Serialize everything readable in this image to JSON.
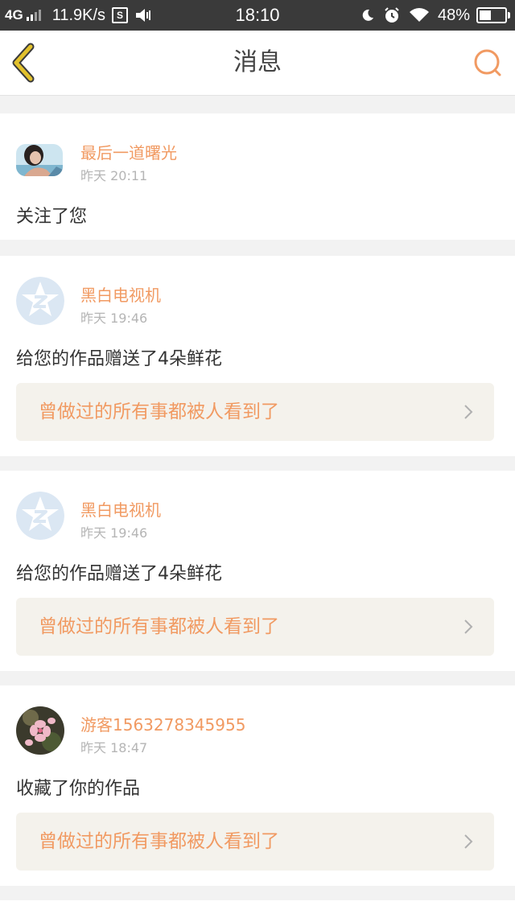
{
  "status_bar": {
    "network": "4G",
    "speed": "11.9K/s",
    "sim_label": "S",
    "time": "18:10",
    "battery": "48%",
    "battery_level": 0.48
  },
  "header": {
    "title": "消息",
    "back_icon": "chevron-left-icon",
    "search_icon": "search-icon"
  },
  "colors": {
    "accent": "#f19a62",
    "back_arrow": "#e2c12c",
    "text": "#333333",
    "muted": "#b5b5b5",
    "work_box_bg": "#f4f2ec"
  },
  "messages": [
    {
      "username": "最后一道曙光",
      "time": "昨天 20:11",
      "action": "关注了您",
      "avatar": "user-photo"
    },
    {
      "username": "黑白电视机",
      "time": "昨天 19:46",
      "action": "给您的作品赠送了4朵鲜花",
      "work_title": "曾做过的所有事都被人看到了",
      "avatar": "default-avatar-icon"
    },
    {
      "username": "黑白电视机",
      "time": "昨天 19:46",
      "action": "给您的作品赠送了4朵鲜花",
      "work_title": "曾做过的所有事都被人看到了",
      "avatar": "default-avatar-icon"
    },
    {
      "username": "游客1563278345955",
      "time": "昨天 18:47",
      "action": "收藏了你的作品",
      "work_title": "曾做过的所有事都被人看到了",
      "avatar": "flower-photo"
    }
  ]
}
